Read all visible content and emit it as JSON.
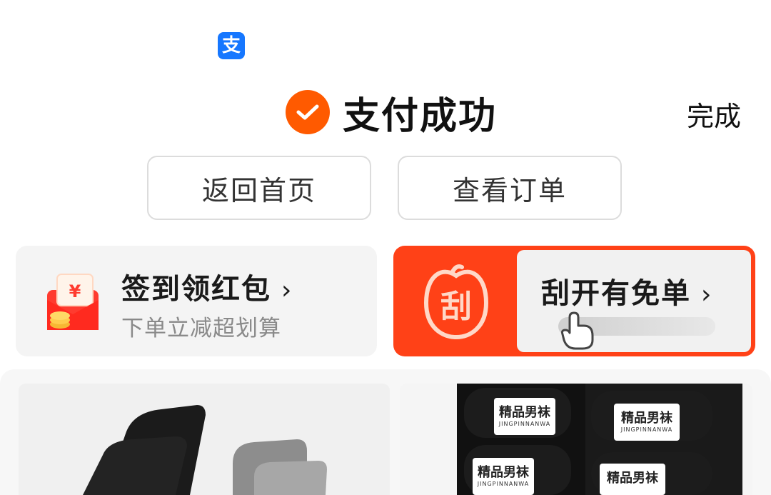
{
  "header": {
    "app_icon_glyph": "支",
    "title": "支付成功",
    "done_label": "完成"
  },
  "actions": {
    "home_label": "返回首页",
    "orders_label": "查看订单"
  },
  "promo_signin": {
    "title": "签到领红包",
    "subtitle": "下单立减超划算",
    "chevron": "›",
    "envelope_symbol": "¥"
  },
  "promo_scratch": {
    "badge_text": "刮",
    "title": "刮开有免单",
    "chevron": "›"
  },
  "products": {
    "items": [
      {
        "label": ""
      },
      {
        "label": "精品男袜",
        "sublabel": "JINGPINNANWA"
      }
    ]
  },
  "colors": {
    "accent_orange": "#ff5a00",
    "scratch_red": "#ff4117",
    "alipay_blue": "#1677ff"
  }
}
